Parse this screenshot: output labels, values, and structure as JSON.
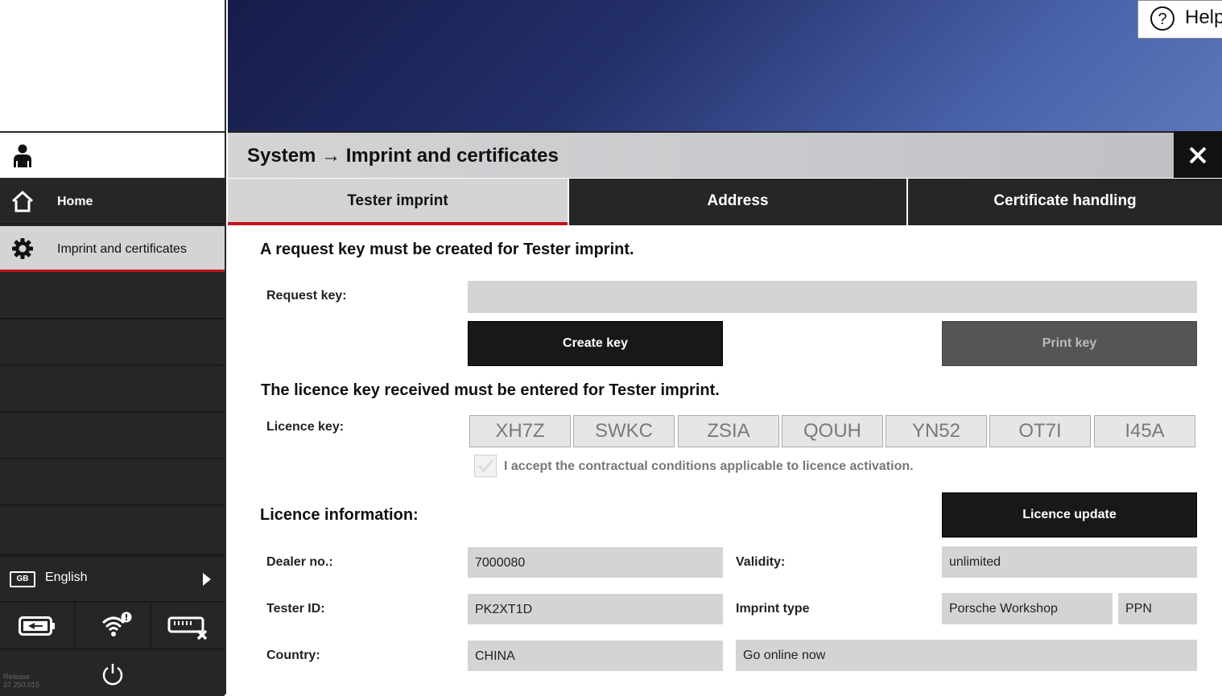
{
  "help": {
    "label": "Help",
    "icon": "question-circle-icon"
  },
  "sidebar": {
    "user_icon": "person-icon",
    "items": [
      {
        "label": "Home",
        "icon": "home-icon"
      },
      {
        "label": "Imprint and certificates",
        "icon": "gear-icon"
      }
    ],
    "language": {
      "code": "GB",
      "label": "English"
    },
    "status_icons": [
      "battery-icon",
      "wifi-alert-icon",
      "vci-disconnected-icon"
    ],
    "power_icon": "power-icon",
    "release": {
      "label": "Release",
      "version": "37.250.015"
    }
  },
  "header": {
    "breadcrumb_root": "System",
    "breadcrumb_arrow": "→",
    "breadcrumb_page": "Imprint and certificates",
    "close_symbol": "✕"
  },
  "tabs": [
    {
      "label": "Tester imprint",
      "active": true
    },
    {
      "label": "Address",
      "active": false
    },
    {
      "label": "Certificate handling",
      "active": false
    }
  ],
  "request": {
    "heading": "A request key must be created for Tester imprint.",
    "label": "Request key:",
    "value": "",
    "create_button": "Create key",
    "print_button": "Print key"
  },
  "licence": {
    "heading": "The licence key received must be entered for Tester imprint.",
    "label": "Licence key:",
    "segments": [
      "XH7Z",
      "SWKC",
      "ZSIA",
      "QOUH",
      "YN52",
      "OT7I",
      "I45A"
    ],
    "accept_text": "I accept the contractual conditions applicable to licence activation.",
    "accept_checked": false
  },
  "info": {
    "heading": "Licence information:",
    "update_button": "Licence update",
    "dealer_label": "Dealer no.:",
    "dealer_value": "7000080",
    "validity_label": "Validity:",
    "validity_value": "unlimited",
    "tester_label": "Tester ID:",
    "tester_value": "PK2XT1D",
    "imprint_label": "Imprint type",
    "imprint_value": "Porsche Workshop",
    "imprint_code": "PPN",
    "country_label": "Country:",
    "country_value": "CHINA",
    "online_value": "Go online now"
  },
  "colors": {
    "accent": "#c0141c",
    "dark": "#262626",
    "field": "#d4d4d4"
  }
}
